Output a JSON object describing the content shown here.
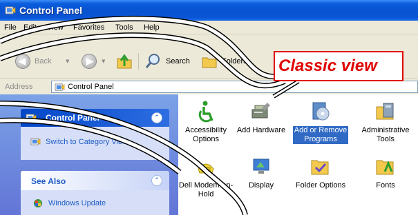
{
  "window": {
    "title": "Control Panel"
  },
  "menu": {
    "file": "File",
    "edit": "Edit",
    "view": "View",
    "favorites": "Favorites",
    "tools": "Tools",
    "help": "Help"
  },
  "toolbar": {
    "back_label": "Back",
    "search_label": "Search",
    "folders_label": "Folders"
  },
  "address": {
    "label": "Address",
    "value": "Control Panel"
  },
  "left_pane": {
    "panel_title": "Control Panel",
    "switch_link": "Switch to Category View",
    "see_also_title": "See Also",
    "windows_update": "Windows Update"
  },
  "items": [
    {
      "label": "Accessibility Options",
      "icon": "accessibility-icon",
      "selected": false
    },
    {
      "label": "Add Hardware",
      "icon": "add-hardware-icon",
      "selected": false
    },
    {
      "label": "Add or Remove Programs",
      "icon": "add-remove-programs-icon",
      "selected": true
    },
    {
      "label": "Administrative Tools",
      "icon": "administrative-tools-icon",
      "selected": false
    },
    {
      "label": "Dell Modem-on-Hold",
      "icon": "modem-phone-icon",
      "selected": false
    },
    {
      "label": "Display",
      "icon": "display-icon",
      "selected": false
    },
    {
      "label": "Folder Options",
      "icon": "folder-options-icon",
      "selected": false
    },
    {
      "label": "Fonts",
      "icon": "fonts-icon",
      "selected": false
    }
  ],
  "callout": {
    "text": "Classic view",
    "color": "#E00000"
  },
  "colors": {
    "titlebar_blue": "#0A56D6",
    "left_pane_blue": "#6375D6",
    "selection_blue": "#316AC5"
  }
}
